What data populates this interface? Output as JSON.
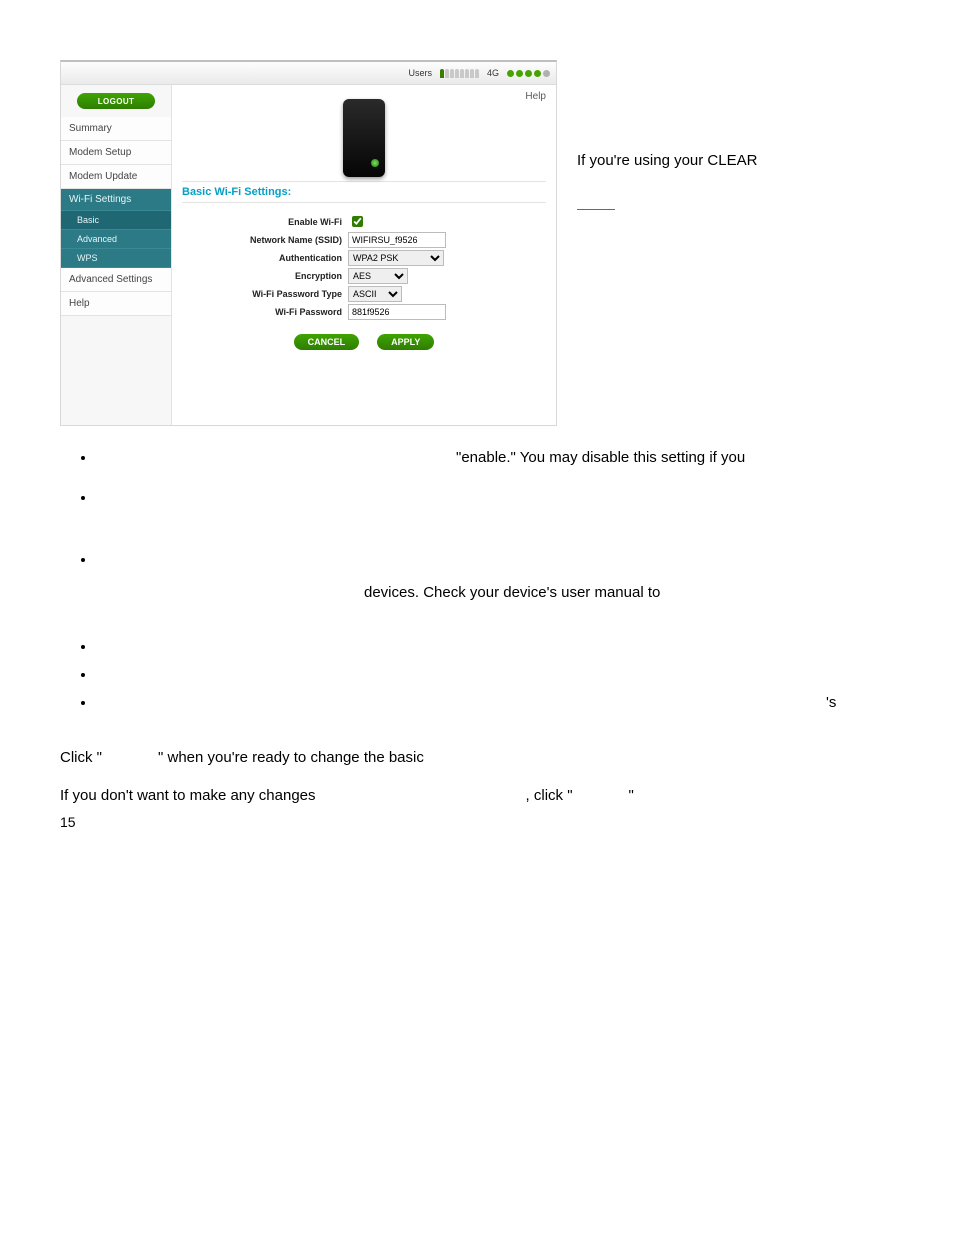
{
  "topbar": {
    "users_label": "Users",
    "sig_label": "4G"
  },
  "sidebar": {
    "logout": "LOGOUT",
    "items": [
      "Summary",
      "Modem Setup",
      "Modem Update"
    ],
    "group": {
      "head": "Wi-Fi Settings",
      "subs": [
        "Basic",
        "Advanced",
        "WPS"
      ]
    },
    "after": [
      "Advanced Settings",
      "Help"
    ]
  },
  "main": {
    "help": "Help",
    "section_title": "Basic Wi-Fi Settings:",
    "fields": {
      "enable": "Enable Wi-Fi",
      "ssid": "Network Name (SSID)",
      "ssid_val": "WIFIRSU_f9526",
      "auth": "Authentication",
      "auth_val": "WPA2 PSK",
      "enc": "Encryption",
      "enc_val": "AES",
      "pwtype": "Wi-Fi Password Type",
      "pwtype_val": "ASCII",
      "pw": "Wi-Fi Password",
      "pw_val": "881f9526"
    },
    "buttons": {
      "cancel": "CANCEL",
      "apply": "APPLY"
    }
  },
  "caption": {
    "line1": "If you're using your CLEAR"
  },
  "bullets": {
    "b1_right": "\"enable.\"  You may disable this setting if you",
    "b3_right": "devices.  Check your device's user manual to",
    "b6_right": "'s"
  },
  "para": {
    "p1_a": "Click \"",
    "p1_b": "\" when you're ready to change the basic",
    "p2_a": "If you don't want to make any changes",
    "p2_b": ", click \"",
    "p2_c": "\""
  },
  "page_number": "15"
}
